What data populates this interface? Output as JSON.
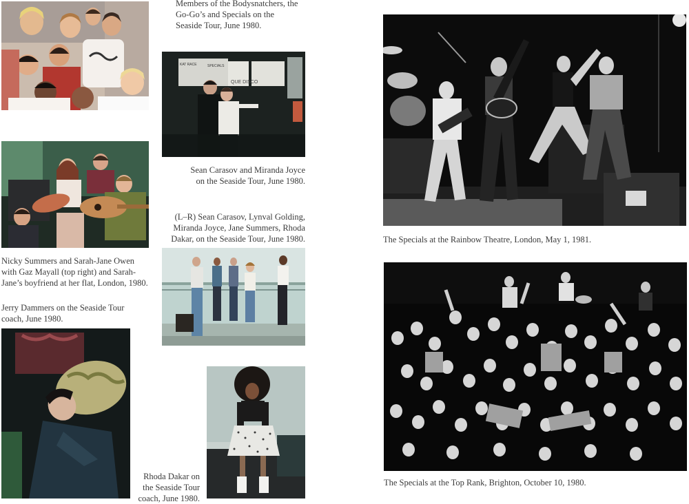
{
  "captions": {
    "bodysnatchers": "Members of the Bodysnatchers, the Go-Go’s and Specials on the Seaside Tour, June 1980.",
    "carasov_joyce": "Sean Carasov and Miranda Joyce on the Seaside Tour, June 1980.",
    "group_lr": "(L–R) Sean Carasov, Lynval Golding, Miranda Joyce, Jane Summers, Rhoda Dakar, on the Seaside Tour, June 1980.",
    "nicky_summers": "Nicky Summers and Sarah-Jane Owen with Gaz Mayall (top right) and Sarah-Jane’s boyfriend at her flat, London, 1980.",
    "jerry_dammers": "Jerry Dammers on the Seaside Tour coach, June 1980.",
    "rhoda_dakar": "Rhoda Dakar on the Seaside Tour coach, June 1980.",
    "rainbow": "The Specials at the Rainbow Theatre, London, May 1, 1981.",
    "top_rank": "The Specials at the Top Rank, Brighton, October 10, 1980."
  },
  "photo_text": {
    "poster_disco": "QUE DISCO",
    "poster_specials": "SPECIALS",
    "poster_kat": "KAT RACE"
  },
  "colors": {
    "caption": "#3b3b3b",
    "page": "#ffffff"
  }
}
